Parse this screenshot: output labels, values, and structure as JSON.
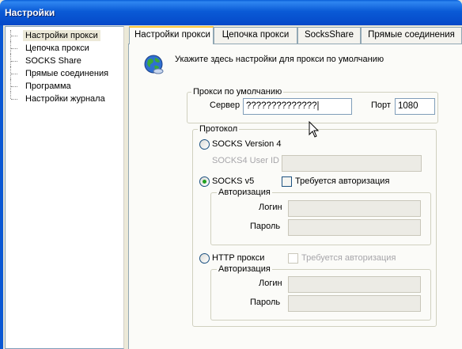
{
  "window": {
    "title": "Настройки"
  },
  "tree": {
    "items": [
      {
        "label": "Настройки прокси",
        "selected": true
      },
      {
        "label": "Цепочка прокси"
      },
      {
        "label": "SOCKS Share"
      },
      {
        "label": "Прямые соединения"
      },
      {
        "label": "Программа"
      },
      {
        "label": "Настройки журнала"
      }
    ]
  },
  "tabs": [
    {
      "label": "Настройки прокси",
      "active": true
    },
    {
      "label": "Цепочка прокси"
    },
    {
      "label": "SocksShare"
    },
    {
      "label": "Прямые соединения"
    }
  ],
  "panel": {
    "hint": "Укажите здесь настройки для прокси по умолчанию",
    "default_proxy": {
      "legend": "Прокси по умолчанию",
      "server_label": "Сервер",
      "server_value": "??????????????|",
      "port_label": "Порт",
      "port_value": "1080"
    },
    "protocol": {
      "legend": "Протокол",
      "socks4": {
        "label": "SOCKS Version 4",
        "selected": false
      },
      "socks4_user_id_label": "SOCKS4 User ID",
      "socks5": {
        "label": "SOCKS v5",
        "selected": true
      },
      "socks5_auth_required": {
        "label": "Требуется авторизация",
        "checked": false
      },
      "socks5_auth": {
        "legend": "Авторизация",
        "login_label": "Логин",
        "password_label": "Пароль"
      },
      "http": {
        "label": "HTTP прокси",
        "selected": false
      },
      "http_auth_required": {
        "label": "Требуется авторизация",
        "checked": false,
        "enabled": false
      },
      "http_auth": {
        "legend": "Авторизация",
        "login_label": "Логин",
        "password_label": "Пароль"
      }
    }
  },
  "colors": {
    "titlebar": "#0a5ad6",
    "tab_highlight": "#ffc73c",
    "radio_dot": "#21a121"
  }
}
